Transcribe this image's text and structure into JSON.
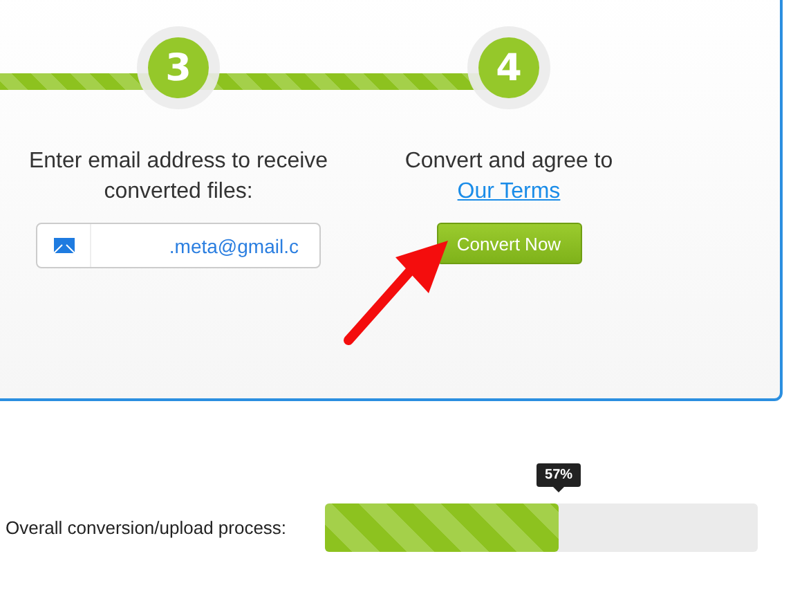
{
  "steps": [
    {
      "number": "3",
      "done": true,
      "lines": [
        "Enter email address to receive",
        "converted files:"
      ],
      "kind": "email",
      "field": {
        "value": ".meta@gmail.c"
      }
    },
    {
      "number": "4",
      "done": true,
      "lines": [
        "Convert and agree to"
      ],
      "kind": "convert",
      "link": "Our Terms",
      "button": "Convert Now"
    }
  ],
  "progress": {
    "label": "Overall conversion/upload process:",
    "level": 0.54,
    "tooltip": "57%"
  }
}
